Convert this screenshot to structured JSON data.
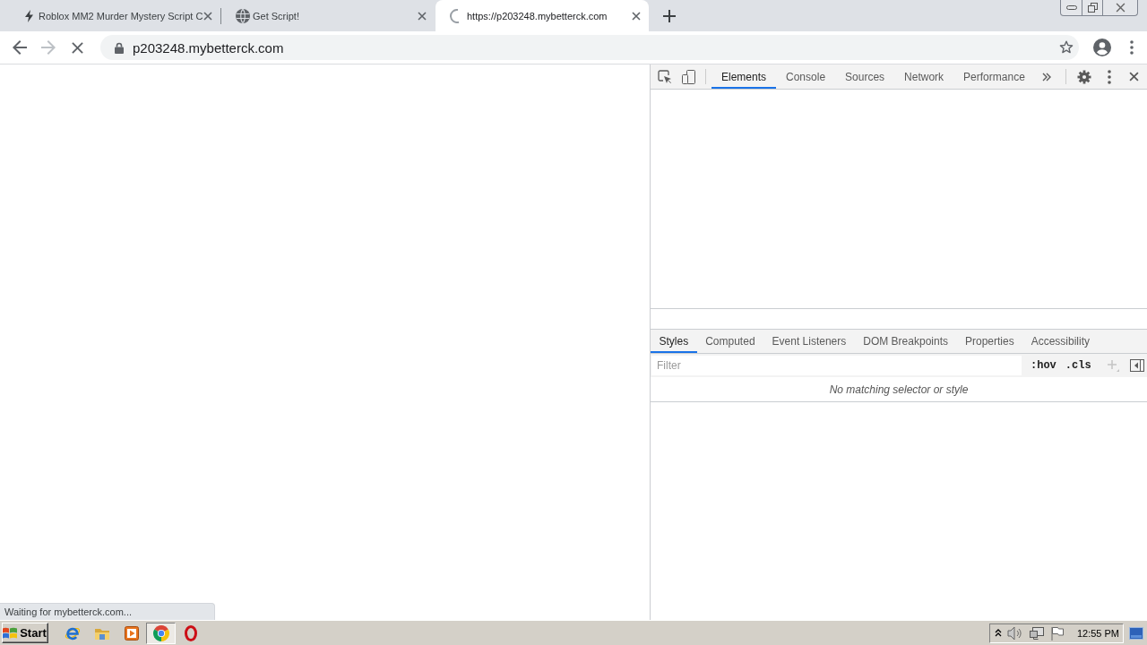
{
  "browser": {
    "tabs": [
      {
        "title": "Roblox MM2 Murder Mystery Script C",
        "kind": "bolt",
        "selected": false
      },
      {
        "title": "Get Script!",
        "kind": "globe",
        "selected": false
      },
      {
        "title": "https://p203248.mybetterck.com",
        "kind": "loading",
        "selected": true
      }
    ],
    "nav_buttons": [
      {
        "kind": "back",
        "disabled": false
      },
      {
        "kind": "forward",
        "disabled": true
      },
      {
        "kind": "stop",
        "disabled": false
      }
    ],
    "address_bar": {
      "url": "p203248.mybetterck.com"
    },
    "status_bubble": "Waiting for mybetterck.com..."
  },
  "devtools": {
    "tabs": [
      {
        "label": "Elements",
        "selected": true
      },
      {
        "label": "Console",
        "selected": false
      },
      {
        "label": "Sources",
        "selected": false
      },
      {
        "label": "Network",
        "selected": false
      },
      {
        "label": "Performance",
        "selected": false
      }
    ],
    "styles_pane": {
      "tabs": [
        {
          "label": "Styles",
          "selected": true
        },
        {
          "label": "Computed",
          "selected": false
        },
        {
          "label": "Event Listeners",
          "selected": false
        },
        {
          "label": "DOM Breakpoints",
          "selected": false
        },
        {
          "label": "Properties",
          "selected": false
        },
        {
          "label": "Accessibility",
          "selected": false
        }
      ],
      "filter": {
        "placeholder": "Filter"
      },
      "toggles": [
        ":hov",
        ".cls"
      ],
      "new_rule_button": {
        "disabled": true
      },
      "message": "No matching selector or style"
    }
  },
  "taskbar": {
    "start": "Start",
    "apps": [
      {
        "kind": "web",
        "selected": false
      },
      {
        "kind": "files",
        "selected": false
      },
      {
        "kind": "media",
        "selected": false
      },
      {
        "kind": "browser",
        "selected": true
      },
      {
        "kind": "ring",
        "selected": false
      }
    ],
    "clock": "12:55 PM"
  }
}
